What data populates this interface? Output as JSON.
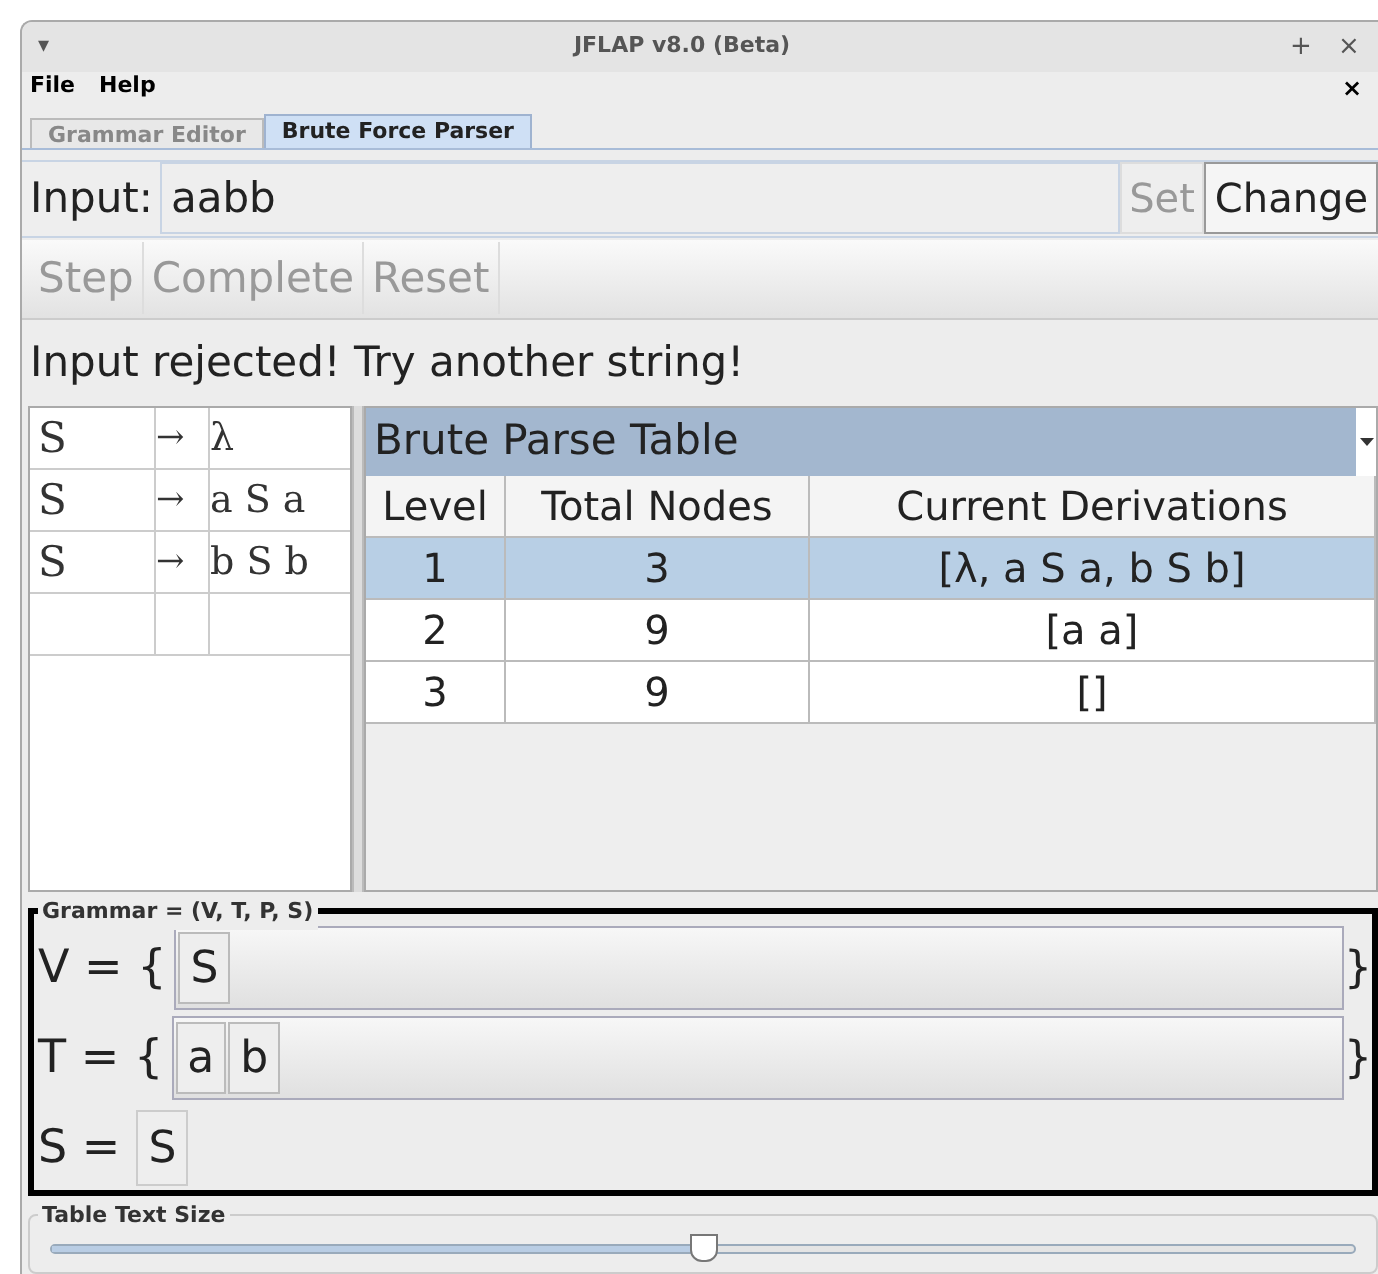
{
  "window": {
    "title": "JFLAP v8.0 (Beta)",
    "menu": "▾",
    "controls": [
      "+",
      "×"
    ]
  },
  "menu": [
    "File",
    "Help"
  ],
  "menu_close": "×",
  "tabs": [
    {
      "label": "Grammar Editor",
      "selected": false
    },
    {
      "label": "Brute Force Parser",
      "selected": true
    }
  ],
  "input": {
    "label": "Input:",
    "value": "aabb"
  },
  "buttons": [
    {
      "label": "Set",
      "disabled": true
    },
    {
      "label": "Change",
      "disabled": false
    }
  ],
  "actions": [
    {
      "label": "Step",
      "disabled": true
    },
    {
      "label": "Complete",
      "disabled": true
    },
    {
      "label": "Reset",
      "disabled": true
    }
  ],
  "message": "Input rejected! Try another string!",
  "productions": [
    {
      "lhs": "S",
      "arrow": "→",
      "rhs": "λ"
    },
    {
      "lhs": "S",
      "arrow": "→",
      "rhs": "a S a"
    },
    {
      "lhs": "S",
      "arrow": "→",
      "rhs": "b S b"
    }
  ],
  "table": {
    "view": "Brute Parse Table",
    "columns": [
      "Level",
      "Total Nodes",
      "Current Derivations"
    ],
    "rows": [
      {
        "cells": [
          "1",
          "3",
          "[λ, a S a, b S b]"
        ],
        "selected": true
      },
      {
        "cells": [
          "2",
          "9",
          "[a a]"
        ],
        "selected": false
      },
      {
        "cells": [
          "3",
          "9",
          "[]"
        ],
        "selected": false
      }
    ]
  },
  "grammar": {
    "title": "Grammar = (V, T, P, S)",
    "sets": [
      {
        "label": "V = {",
        "items": [
          "S"
        ],
        "close": "}"
      },
      {
        "label": "T = {",
        "items": [
          "a",
          "b"
        ],
        "close": "}"
      }
    ],
    "start": {
      "label": "S =",
      "value": "S"
    }
  },
  "text_size": {
    "title": "Table Text Size",
    "level": 0.5
  }
}
